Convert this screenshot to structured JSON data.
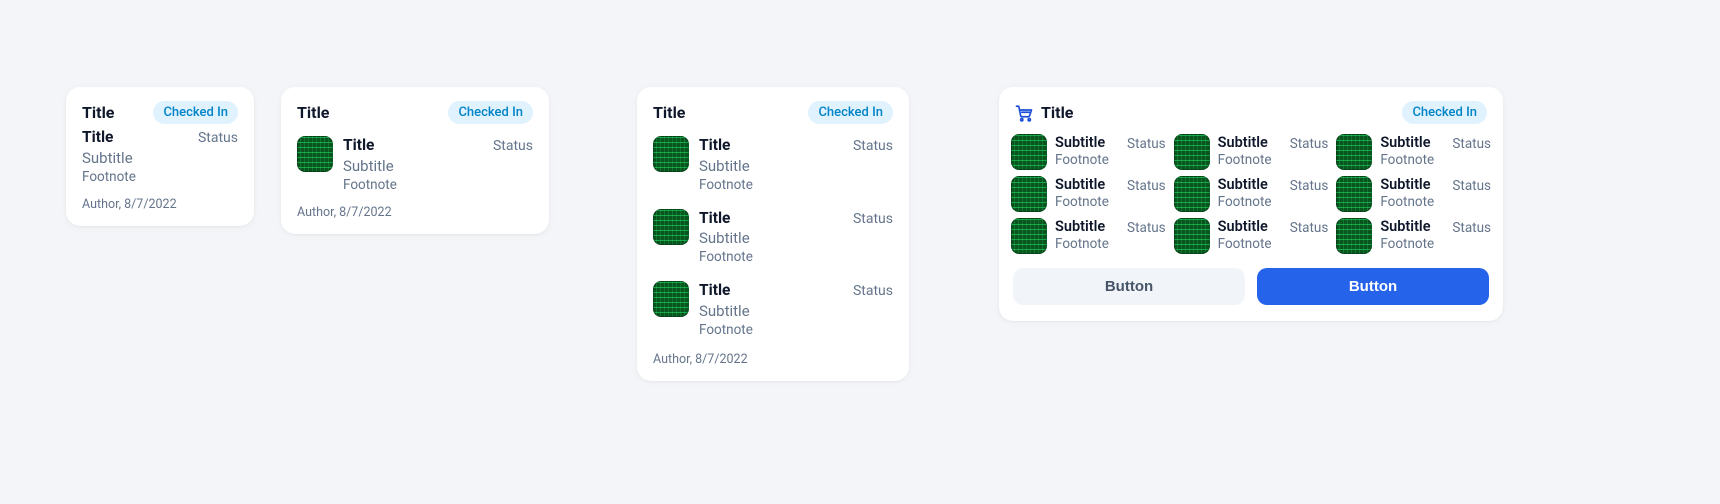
{
  "badge_label": "Checked In",
  "card1": {
    "title": "Title",
    "item": {
      "title": "Title",
      "subtitle": "Subtitle",
      "footnote": "Footnote",
      "status": "Status"
    },
    "author_line": "Author, 8/7/2022"
  },
  "card2": {
    "title": "Title",
    "item": {
      "title": "Title",
      "subtitle": "Subtitle",
      "footnote": "Footnote",
      "status": "Status"
    },
    "author_line": "Author, 8/7/2022"
  },
  "card3": {
    "title": "Title",
    "items": [
      {
        "title": "Title",
        "subtitle": "Subtitle",
        "footnote": "Footnote",
        "status": "Status"
      },
      {
        "title": "Title",
        "subtitle": "Subtitle",
        "footnote": "Footnote",
        "status": "Status"
      },
      {
        "title": "Title",
        "subtitle": "Subtitle",
        "footnote": "Footnote",
        "status": "Status"
      }
    ],
    "author_line": "Author, 8/7/2022"
  },
  "card4": {
    "title": "Title",
    "items": [
      {
        "subtitle": "Subtitle",
        "footnote": "Footnote",
        "status": "Status"
      },
      {
        "subtitle": "Subtitle",
        "footnote": "Footnote",
        "status": "Status"
      },
      {
        "subtitle": "Subtitle",
        "footnote": "Footnote",
        "status": "Status"
      },
      {
        "subtitle": "Subtitle",
        "footnote": "Footnote",
        "status": "Status"
      },
      {
        "subtitle": "Subtitle",
        "footnote": "Footnote",
        "status": "Status"
      },
      {
        "subtitle": "Subtitle",
        "footnote": "Footnote",
        "status": "Status"
      },
      {
        "subtitle": "Subtitle",
        "footnote": "Footnote",
        "status": "Status"
      },
      {
        "subtitle": "Subtitle",
        "footnote": "Footnote",
        "status": "Status"
      },
      {
        "subtitle": "Subtitle",
        "footnote": "Footnote",
        "status": "Status"
      }
    ],
    "button_secondary": "Button",
    "button_primary": "Button"
  }
}
